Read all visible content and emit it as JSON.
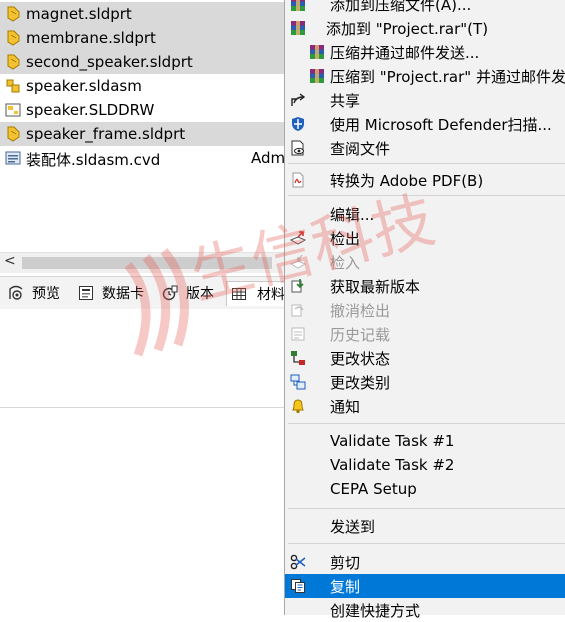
{
  "files": [
    {
      "name": "magnet.sldprt",
      "icon": "part-icon",
      "selected": true
    },
    {
      "name": "membrane.sldprt",
      "icon": "part-icon",
      "selected": true
    },
    {
      "name": "second_speaker.sldprt",
      "icon": "part-icon",
      "selected": true
    },
    {
      "name": "speaker.sldasm",
      "icon": "assembly-icon",
      "selected": false
    },
    {
      "name": "speaker.SLDDRW",
      "icon": "drawing-icon",
      "selected": false
    },
    {
      "name": "speaker_frame.sldprt",
      "icon": "part-icon",
      "selected": true
    },
    {
      "name": "装配体.sldasm.cvd",
      "icon": "cvd-file-icon",
      "selected": false,
      "user": "Adm"
    }
  ],
  "scroll_left_glyph": "<",
  "tabs": [
    {
      "label": "预览",
      "icon": "eye-icon"
    },
    {
      "label": "数据卡",
      "icon": "datacard-icon"
    },
    {
      "label": "版本",
      "icon": "version-icon"
    },
    {
      "label": "材料",
      "icon": "table-icon"
    }
  ],
  "watermark_text": "生信科技",
  "menu": {
    "items": [
      {
        "label": "添加到压缩文件(A)...",
        "icon": "winrar-icon"
      },
      {
        "label": "添加到 \"Project.rar\"(T)",
        "icon": "winrar-icon"
      },
      {
        "label": "压缩并通过邮件发送...",
        "icon": "winrar-icon"
      },
      {
        "label": "压缩到 \"Project.rar\" 并通过邮件发送",
        "icon": "winrar-icon"
      },
      {
        "label": "共享",
        "icon": "share-icon"
      },
      {
        "label": "使用 Microsoft Defender扫描...",
        "icon": "defender-shield-icon"
      },
      {
        "label": "查阅文件",
        "icon": "view-file-icon"
      },
      {
        "label": "转换为 Adobe PDF(B)",
        "icon": "pdf-icon"
      },
      {
        "label": "编辑...",
        "icon": ""
      },
      {
        "label": "检出",
        "icon": "checkout-icon"
      },
      {
        "label": "检入",
        "icon": "checkin-icon",
        "disabled": true
      },
      {
        "label": "获取最新版本",
        "icon": "get-latest-icon"
      },
      {
        "label": "撤消检出",
        "icon": "undo-checkout-icon",
        "disabled": true
      },
      {
        "label": "历史记载",
        "icon": "history-icon",
        "disabled": true
      },
      {
        "label": "更改状态",
        "icon": "change-state-icon"
      },
      {
        "label": "更改类别",
        "icon": "change-category-icon"
      },
      {
        "label": "通知",
        "icon": "bell-icon"
      },
      {
        "label": "Validate Task #1",
        "icon": ""
      },
      {
        "label": "Validate Task #2",
        "icon": ""
      },
      {
        "label": "CEPA Setup",
        "icon": ""
      },
      {
        "label": "发送到",
        "icon": ""
      },
      {
        "label": "剪切",
        "icon": "scissors-icon"
      },
      {
        "label": "复制",
        "icon": "copy-icon",
        "highlighted": true
      },
      {
        "label": "创建快捷方式",
        "icon": ""
      }
    ]
  },
  "colors": {
    "selection": "#d9d9d9",
    "menu_bg": "#f2f2f2",
    "highlight": "#0078d7",
    "watermark": "#e45a50"
  }
}
